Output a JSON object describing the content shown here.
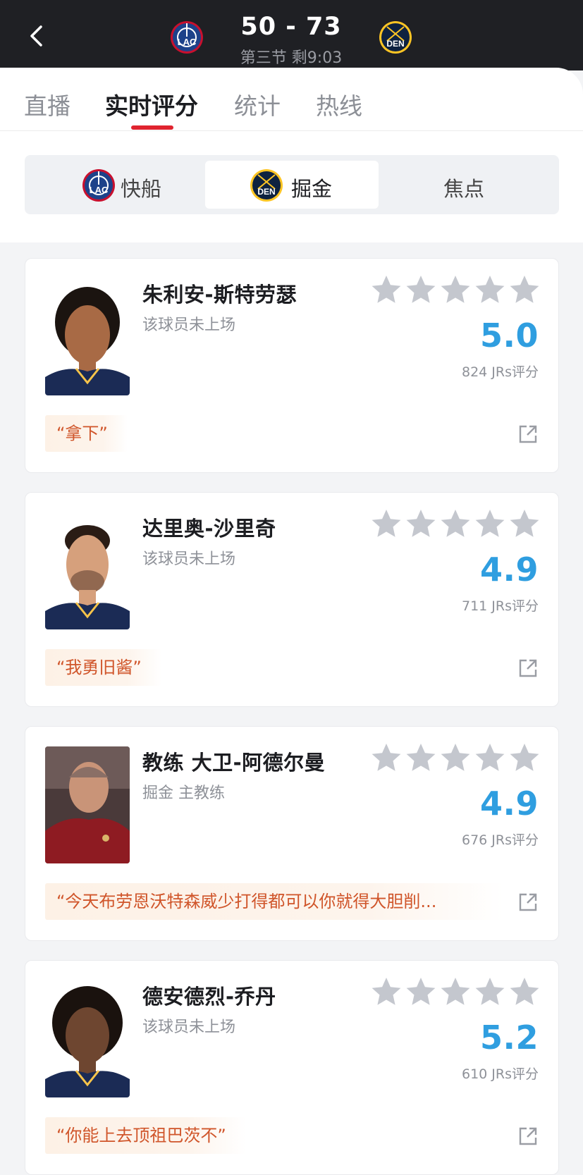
{
  "header": {
    "score": "50 - 73",
    "period": "第三节 剩9:03",
    "away_team": {
      "abbr": "LAC",
      "logo_icon": "clippers-logo-icon",
      "color": "#1d428a"
    },
    "home_team": {
      "abbr": "DEN",
      "logo_icon": "nuggets-logo-icon",
      "color": "#0e2240"
    }
  },
  "tabs": [
    {
      "label": "直播",
      "active": false
    },
    {
      "label": "实时评分",
      "active": true
    },
    {
      "label": "统计",
      "active": false
    },
    {
      "label": "热线",
      "active": false
    }
  ],
  "segments": [
    {
      "label": "快船",
      "active": false
    },
    {
      "label": "掘金",
      "active": true
    },
    {
      "label": "焦点",
      "active": false
    }
  ],
  "players": [
    {
      "name": "朱利安-斯特劳瑟",
      "status": "该球员未上场",
      "score": "5.0",
      "count": "824 JRs评分",
      "quote": "“拿下”"
    },
    {
      "name": "达里奥-沙里奇",
      "status": "该球员未上场",
      "score": "4.9",
      "count": "711 JRs评分",
      "quote": "“我勇旧酱”"
    },
    {
      "name": "教练 大卫-阿德尔曼",
      "status": "掘金 主教练",
      "score": "4.9",
      "count": "676 JRs评分",
      "quote": "“今天布劳恩沃特森威少打得都可以你就得大胆削..."
    },
    {
      "name": "德安德烈-乔丹",
      "status": "该球员未上场",
      "score": "5.2",
      "count": "610 JRs评分",
      "quote": "“你能上去顶祖巴茨不”"
    }
  ],
  "colors": {
    "accent_red": "#e0242f",
    "score_blue": "#2f9ee0",
    "quote_orange": "#d0552a",
    "star_grey": "#c4c7ce"
  }
}
